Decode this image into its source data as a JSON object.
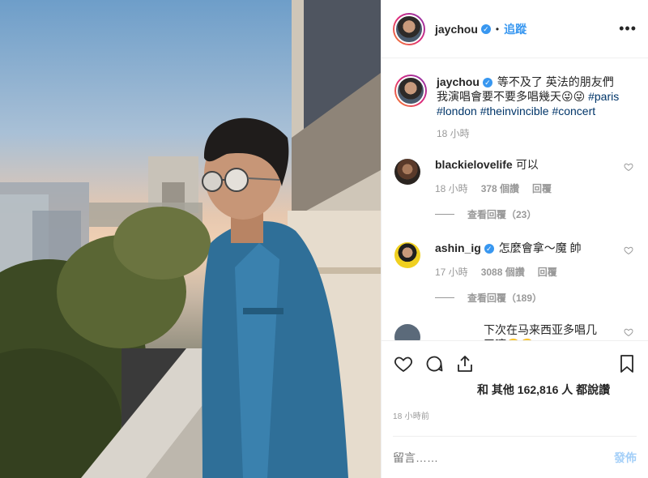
{
  "header": {
    "username": "jaychou",
    "verified_mark": "✓",
    "separator": "•",
    "follow_label": "追蹤",
    "more_label": "•••"
  },
  "caption": {
    "username": "jaychou",
    "text": "等不及了 英法的朋友們 我演唱會要不要多唱幾天😜😜 ",
    "tags": [
      "#paris",
      "#london",
      "#theinvincible",
      "#concert"
    ],
    "time": "18 小時"
  },
  "comments": [
    {
      "username": "blackielovelife",
      "text": "可以",
      "time": "18 小時",
      "likes": "378 個讚",
      "reply_label": "回覆",
      "view_replies": "查看回覆（23）"
    },
    {
      "username": "ashin_ig",
      "verified": true,
      "text": "怎麼會拿～魔 帥",
      "time": "17 小時",
      "likes": "3088 個讚",
      "reply_label": "回覆",
      "view_replies": "查看回覆（189）"
    },
    {
      "username": "",
      "text": "下次在马来西亚多唱几天嘛🤪🤪"
    }
  ],
  "likes_text": "和 其他 162,816 人 都說讚",
  "time_ago": "18 小時前",
  "add_comment": {
    "placeholder": "留言……",
    "post_label": "發佈"
  },
  "colors": {
    "accent": "#3897f0",
    "text": "#262626",
    "muted": "#999999"
  },
  "icons": [
    "heart-icon",
    "comment-icon",
    "share-icon",
    "bookmark-icon"
  ]
}
